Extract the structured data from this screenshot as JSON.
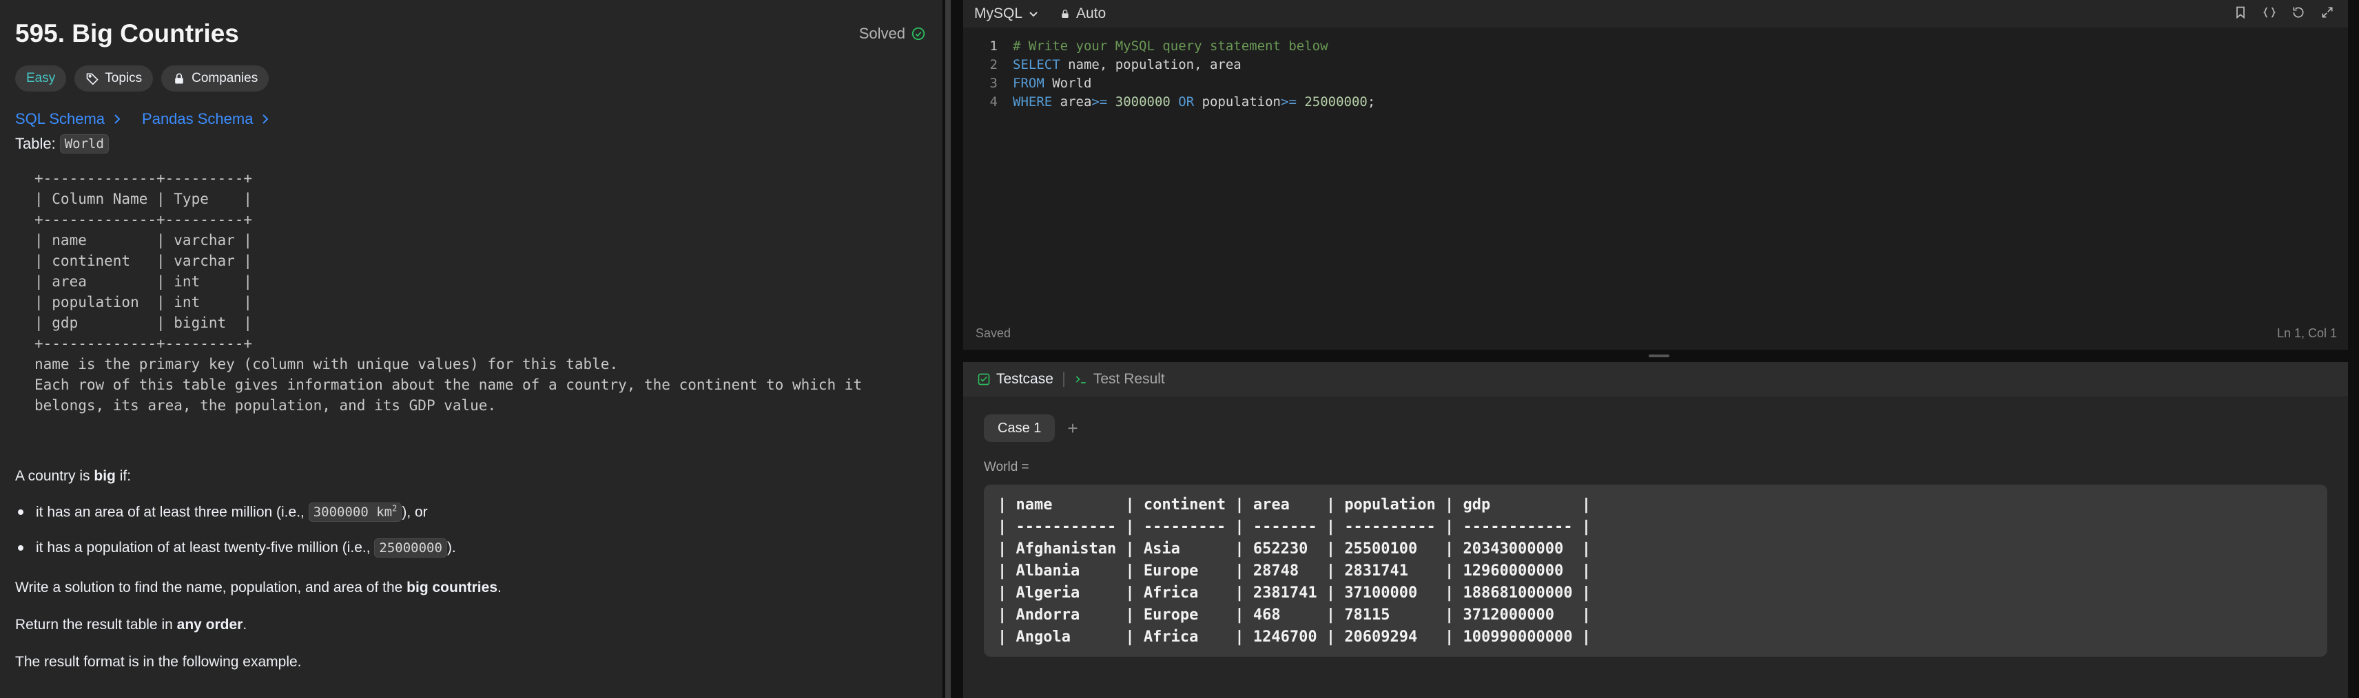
{
  "problem": {
    "title": "595. Big Countries",
    "status": "Solved",
    "tags": [
      "Easy",
      "Topics",
      "Companies"
    ],
    "schema_links": [
      "SQL Schema",
      "Pandas Schema"
    ],
    "table_label": "Table:",
    "table_name": "World",
    "schema_block": "+-------------+---------+\n| Column Name | Type    |\n+-------------+---------+\n| name        | varchar |\n| continent   | varchar |\n| area        | int     |\n| population  | int     |\n| gdp         | bigint  |\n+-------------+---------+\nname is the primary key (column with unique values) for this table.\nEach row of this table gives information about the name of a country, the continent to which it\nbelongs, its area, the population, and its GDP value.",
    "desc_intro_pre": "A country is ",
    "desc_intro_bold": "big",
    "desc_intro_post": " if:",
    "bullet1_pre": "it has an area of at least three million (i.e., ",
    "bullet1_code": "3000000 km",
    "bullet1_sup": "2",
    "bullet1_post": "), or",
    "bullet2_pre": "it has a population of at least twenty-five million (i.e., ",
    "bullet2_code": "25000000",
    "bullet2_post": ").",
    "task_pre": "Write a solution to find the name, population, and area of the ",
    "task_bold": "big countries",
    "task_post": ".",
    "order_pre": "Return the result table in ",
    "order_bold": "any order",
    "order_post": ".",
    "format_text": "The result format is in the following example."
  },
  "editor": {
    "language": "MySQL",
    "mode": "Auto",
    "lines": [
      {
        "n": "1",
        "parts": [
          {
            "t": "# Write your MySQL query statement below",
            "c": "cm"
          }
        ]
      },
      {
        "n": "2",
        "parts": [
          {
            "t": "SELECT",
            "c": "kw"
          },
          {
            "t": " name, population, area",
            "c": "op"
          }
        ]
      },
      {
        "n": "3",
        "parts": [
          {
            "t": "FROM",
            "c": "kw"
          },
          {
            "t": " World",
            "c": "op"
          }
        ]
      },
      {
        "n": "4",
        "parts": [
          {
            "t": "WHERE",
            "c": "kw"
          },
          {
            "t": " area",
            "c": "op"
          },
          {
            "t": ">=",
            "c": "kw"
          },
          {
            "t": " ",
            "c": "op"
          },
          {
            "t": "3000000",
            "c": "nm"
          },
          {
            "t": " ",
            "c": "op"
          },
          {
            "t": "OR",
            "c": "kw"
          },
          {
            "t": " population",
            "c": "op"
          },
          {
            "t": ">=",
            "c": "kw"
          },
          {
            "t": " ",
            "c": "op"
          },
          {
            "t": "25000000",
            "c": "nm"
          },
          {
            "t": ";",
            "c": "op"
          }
        ]
      }
    ],
    "saved_status": "Saved",
    "cursor_pos": "Ln 1, Col 1"
  },
  "testpanel": {
    "tab_testcase": "Testcase",
    "tab_result": "Test Result",
    "case_label": "Case 1",
    "add_label": "+",
    "input_label": "World =",
    "table_text": "| name        | continent | area    | population | gdp          |\n| ----------- | --------- | ------- | ---------- | ------------ |\n| Afghanistan | Asia      | 652230  | 25500100   | 20343000000  |\n| Albania     | Europe    | 28748   | 2831741    | 12960000000  |\n| Algeria     | Africa    | 2381741 | 37100000   | 188681000000 |\n| Andorra     | Europe    | 468     | 78115      | 3712000000   |\n| Angola      | Africa    | 1246700 | 20609294   | 100990000000 |"
  },
  "colors": {
    "accent_green": "#2cbb5d",
    "easy_teal": "#46c6c2",
    "link_blue": "#3c8dff"
  }
}
